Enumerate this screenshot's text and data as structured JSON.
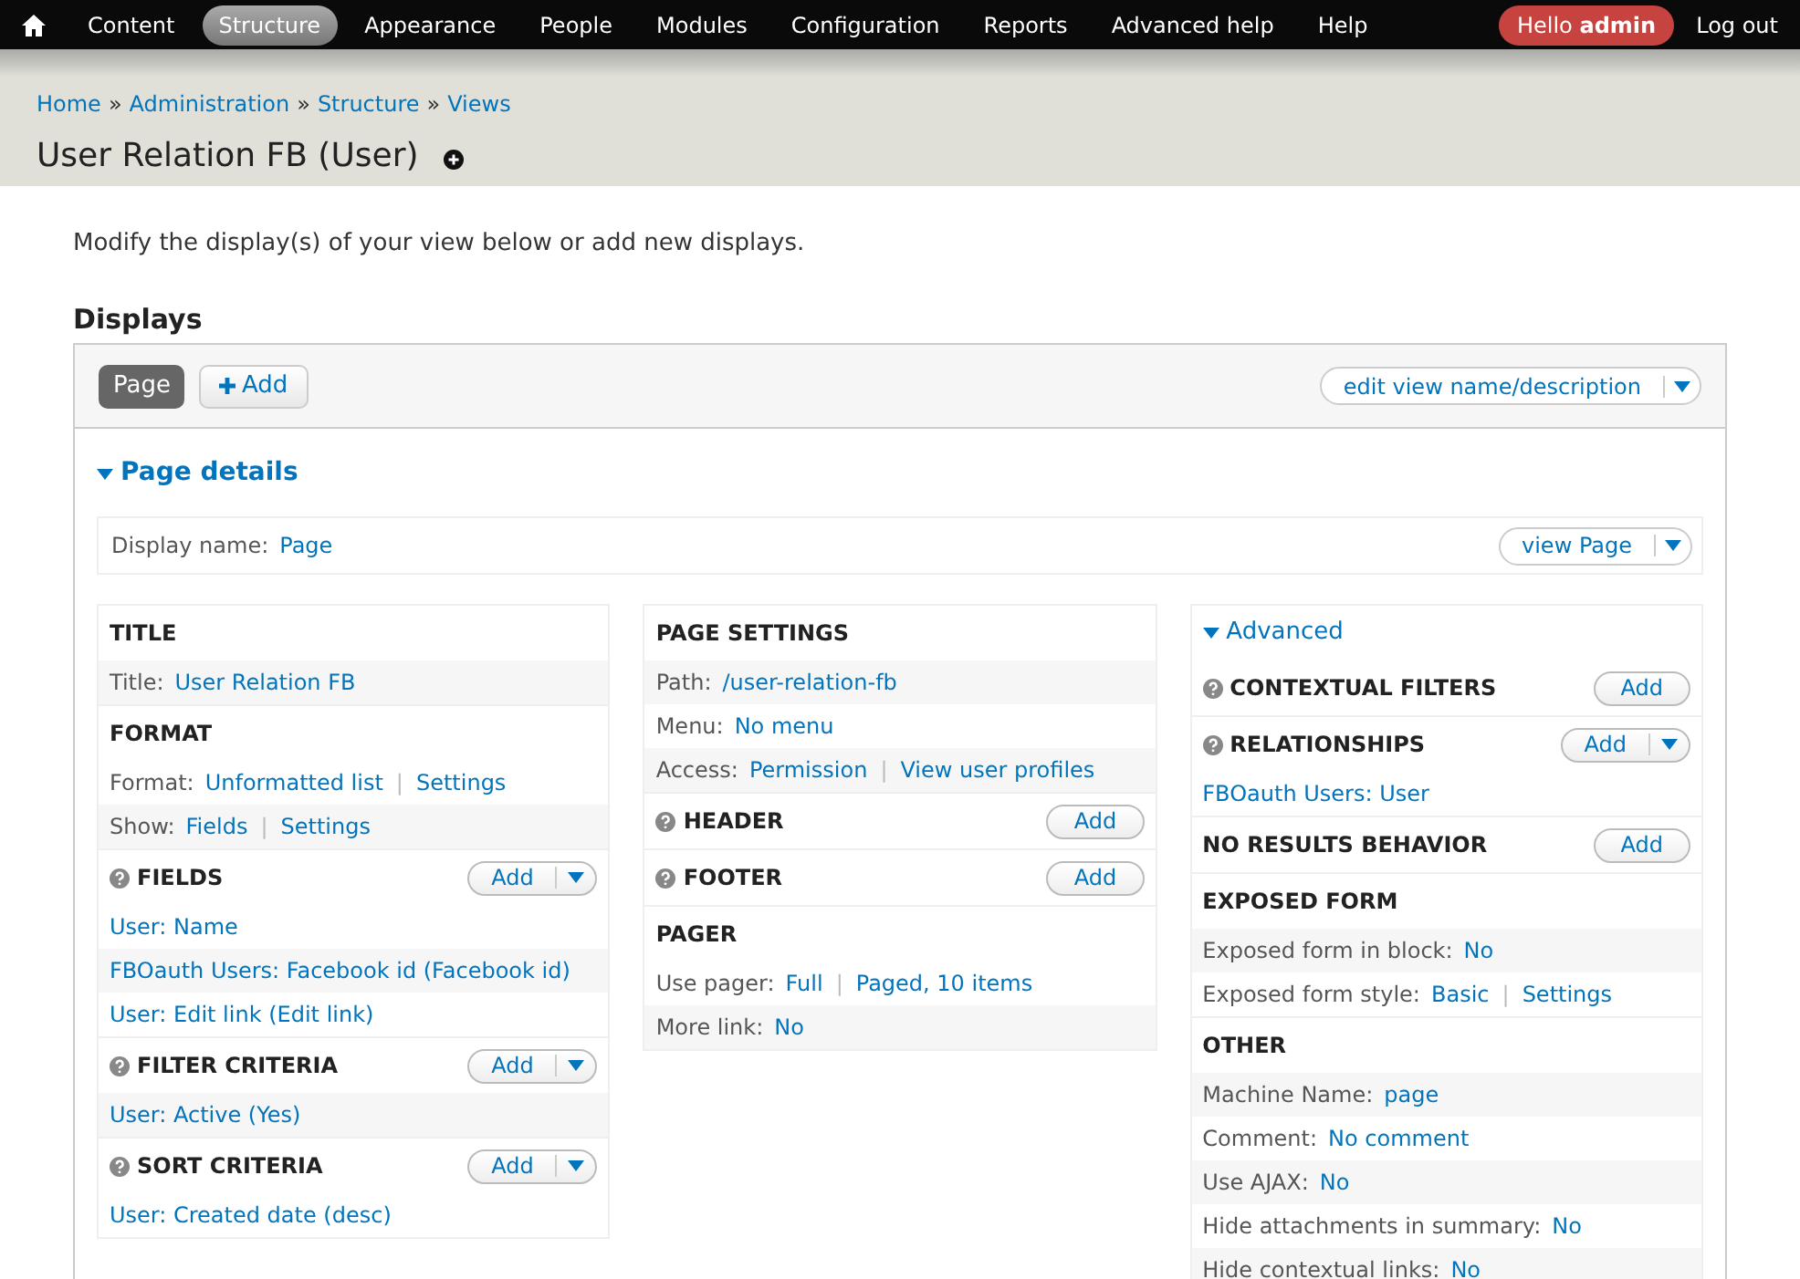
{
  "nav": {
    "items": [
      {
        "label": "Content",
        "selected": false
      },
      {
        "label": "Structure",
        "selected": true
      },
      {
        "label": "Appearance",
        "selected": false
      },
      {
        "label": "People",
        "selected": false
      },
      {
        "label": "Modules",
        "selected": false
      },
      {
        "label": "Configuration",
        "selected": false
      },
      {
        "label": "Reports",
        "selected": false
      },
      {
        "label": "Advanced help",
        "selected": false
      },
      {
        "label": "Help",
        "selected": false
      }
    ],
    "greeting": "Hello",
    "user": "admin",
    "logout": "Log out"
  },
  "breadcrumb": [
    "Home",
    "Administration",
    "Structure",
    "Views"
  ],
  "breadcrumb_separator": "»",
  "link_separator": "|",
  "page_title": "User Relation FB (User)",
  "intro": "Modify the display(s) of your view below or add new displays.",
  "displays_heading": "Displays",
  "display_tabs": [
    {
      "label": "Page",
      "selected": true
    }
  ],
  "add_display": "Add",
  "edit_view": "edit view name/description",
  "details": {
    "title": "Page details",
    "expanded": true,
    "display_name_label": "Display name:",
    "display_name": "Page",
    "view_button": "view Page"
  },
  "columns": [
    {
      "sections": [
        {
          "title": "TITLE",
          "help": false,
          "rows": [
            {
              "label": "Title:",
              "values": [
                "User Relation FB"
              ],
              "shaded": true
            }
          ]
        },
        {
          "title": "FORMAT",
          "help": false,
          "rows": [
            {
              "label": "Format:",
              "values": [
                "Unformatted list",
                "Settings"
              ],
              "shaded": false
            },
            {
              "label": "Show:",
              "values": [
                "Fields",
                "Settings"
              ],
              "shaded": true
            }
          ]
        },
        {
          "title": "FIELDS",
          "help": true,
          "add_button": {
            "label": "Add",
            "kind": "dropdown"
          },
          "rows": [
            {
              "values": [
                "User: Name"
              ],
              "shaded": false
            },
            {
              "values": [
                "FBOauth Users: Facebook id (Facebook id)"
              ],
              "shaded": true
            },
            {
              "values": [
                "User: Edit link (Edit link)"
              ],
              "shaded": false
            }
          ]
        },
        {
          "title": "FILTER CRITERIA",
          "help": true,
          "add_button": {
            "label": "Add",
            "kind": "dropdown"
          },
          "rows": [
            {
              "values": [
                "User: Active (Yes)"
              ],
              "shaded": true
            }
          ]
        },
        {
          "title": "SORT CRITERIA",
          "help": true,
          "add_button": {
            "label": "Add",
            "kind": "dropdown"
          },
          "rows": [
            {
              "values": [
                "User: Created date (desc)"
              ],
              "shaded": false
            }
          ]
        }
      ]
    },
    {
      "sections": [
        {
          "title": "PAGE SETTINGS",
          "help": false,
          "rows": [
            {
              "label": "Path:",
              "values": [
                "/user-relation-fb"
              ],
              "shaded": true
            },
            {
              "label": "Menu:",
              "values": [
                "No menu"
              ],
              "shaded": false
            },
            {
              "label": "Access:",
              "values": [
                "Permission",
                "View user profiles"
              ],
              "shaded": true
            }
          ]
        },
        {
          "title": "HEADER",
          "help": true,
          "add_button": {
            "label": "Add",
            "kind": "plain"
          }
        },
        {
          "title": "FOOTER",
          "help": true,
          "add_button": {
            "label": "Add",
            "kind": "plain"
          }
        },
        {
          "title": "PAGER",
          "help": false,
          "rows": [
            {
              "label": "Use pager:",
              "values": [
                "Full",
                "Paged, 10 items"
              ],
              "shaded": false
            },
            {
              "label": "More link:",
              "values": [
                "No"
              ],
              "shaded": true
            }
          ]
        }
      ]
    },
    {
      "toggle": {
        "label": "Advanced",
        "expanded": true
      },
      "sections": [
        {
          "title": "CONTEXTUAL FILTERS",
          "help": true,
          "add_button": {
            "label": "Add",
            "kind": "plain"
          }
        },
        {
          "title": "RELATIONSHIPS",
          "help": true,
          "add_button": {
            "label": "Add",
            "kind": "dropdown"
          },
          "rows": [
            {
              "values": [
                "FBOauth Users: User"
              ],
              "shaded": false
            }
          ]
        },
        {
          "title": "NO RESULTS BEHAVIOR",
          "help": false,
          "add_button": {
            "label": "Add",
            "kind": "plain"
          }
        },
        {
          "title": "EXPOSED FORM",
          "help": false,
          "rows": [
            {
              "label": "Exposed form in block:",
              "values": [
                "No"
              ],
              "shaded": true
            },
            {
              "label": "Exposed form style:",
              "values": [
                "Basic",
                "Settings"
              ],
              "shaded": false
            }
          ]
        },
        {
          "title": "OTHER",
          "help": false,
          "rows": [
            {
              "label": "Machine Name:",
              "values": [
                "page"
              ],
              "shaded": true
            },
            {
              "label": "Comment:",
              "values": [
                "No comment"
              ],
              "shaded": false
            },
            {
              "label": "Use AJAX:",
              "values": [
                "No"
              ],
              "shaded": true
            },
            {
              "label": "Hide attachments in summary:",
              "values": [
                "No"
              ],
              "shaded": false
            },
            {
              "label": "Hide contextual links:",
              "values": [
                "No"
              ],
              "shaded": true
            }
          ]
        }
      ]
    }
  ]
}
